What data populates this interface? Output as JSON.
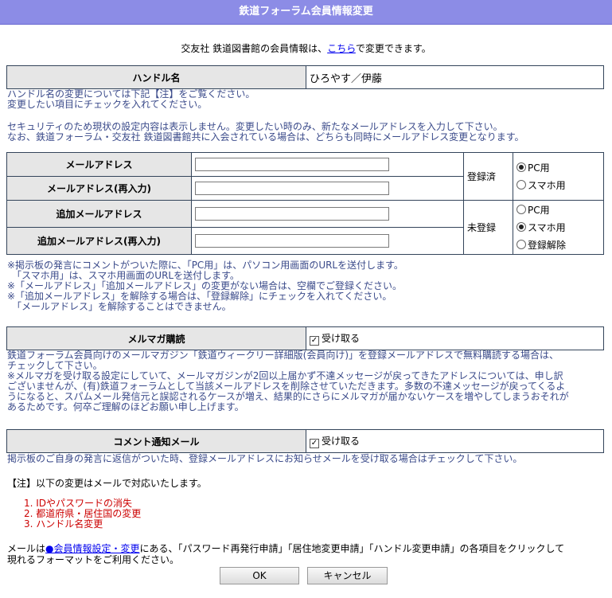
{
  "title": "鉄道フォーラム会員情報変更",
  "intro": {
    "prefix": "交友社 鉄道図書館の会員情報は、",
    "link": "こちら",
    "suffix": "で変更できます。"
  },
  "handle": {
    "label": "ハンドル名",
    "value": "ひろやす／伊藤",
    "notes": [
      "ハンドル名の変更については下記【注】をご覧ください。",
      "変更したい項目にチェックを入れてください。"
    ]
  },
  "security_notes": [
    "セキュリティのため現状の設定内容は表示しません。変更したい時のみ、新たなメールアドレスを入力して下さい。",
    "なお、鉄道フォーラム・交友社 鉄道図書館共に入会されている場合は、どちらも同時にメールアドレス変更となります。"
  ],
  "email": {
    "rows": [
      {
        "label": "メールアドレス",
        "value": ""
      },
      {
        "label": "メールアドレス(再入力)",
        "value": ""
      },
      {
        "label": "追加メールアドレス",
        "value": ""
      },
      {
        "label": "追加メールアドレス(再入力)",
        "value": ""
      }
    ],
    "status1": "登録済",
    "status2": "未登録",
    "radio1": [
      {
        "label": "PC用",
        "checked": true
      },
      {
        "label": "スマホ用",
        "checked": false
      }
    ],
    "radio2": [
      {
        "label": "PC用",
        "checked": false
      },
      {
        "label": "スマホ用",
        "checked": true
      },
      {
        "label": "登録解除",
        "checked": false
      }
    ],
    "notes": [
      "※掲示板の発言にコメントがついた際に、「PC用」は、パソコン用画面のURLを送付します。",
      "　「スマホ用」は、スマホ用画面のURLを送付します。",
      "※「メールアドレス」「追加メールアドレス」の変更がない場合は、空欄でご登録ください。",
      "※「追加メールアドレス」を解除する場合は、「登録解除」にチェックを入れてください。",
      "　「メールアドレス」を解除することはできません。"
    ]
  },
  "magazine": {
    "label": "メルマガ購読",
    "checkbox_label": "受け取る",
    "checked": true,
    "notes": [
      "鉄道フォーラム会員向けのメールマガジン「鉄道ウィークリー詳細版(会員向け)」を登録メールアドレスで無料購読する場合は、",
      "チェックして下さい。",
      "※メルマガを受け取る設定にしていて、メールマガジンが2回以上届かず不達メッセージが戻ってきたアドレスについては、申し訳",
      "ございませんが、(有)鉄道フォーラムとして当該メールアドレスを削除させていただきます。多数の不達メッセージが戻ってくるよ",
      "うになると、スパムメール発信元と誤認されるケースが増え、結果的にさらにメルマガが届かないケースを増やしてしまうおそれが",
      "あるためです。何卒ご理解のほどお願い申し上げます。"
    ]
  },
  "comment": {
    "label": "コメント通知メール",
    "checkbox_label": "受け取る",
    "checked": true,
    "note": "掲示板のご自身の発言に返信がついた時、登録メールアドレスにお知らせメールを受け取る場合はチェックして下さい。"
  },
  "footnote": {
    "heading": "【注】以下の変更はメールで対応いたします。",
    "items": [
      "1.  IDやパスワードの消失",
      "2.  都道府県・居住国の変更",
      "3.  ハンドル名変更"
    ],
    "mail_prefix": "メールは",
    "mail_link": "●会員情報設定・変更",
    "mail_suffix": "にある、「パスワード再発行申請」「居住地変更申請」「ハンドル変更申請」の各項目をクリックして",
    "mail_line2": "現れるフォーマットをご利用ください。"
  },
  "buttons": {
    "ok": "OK",
    "cancel": "キャンセル"
  }
}
